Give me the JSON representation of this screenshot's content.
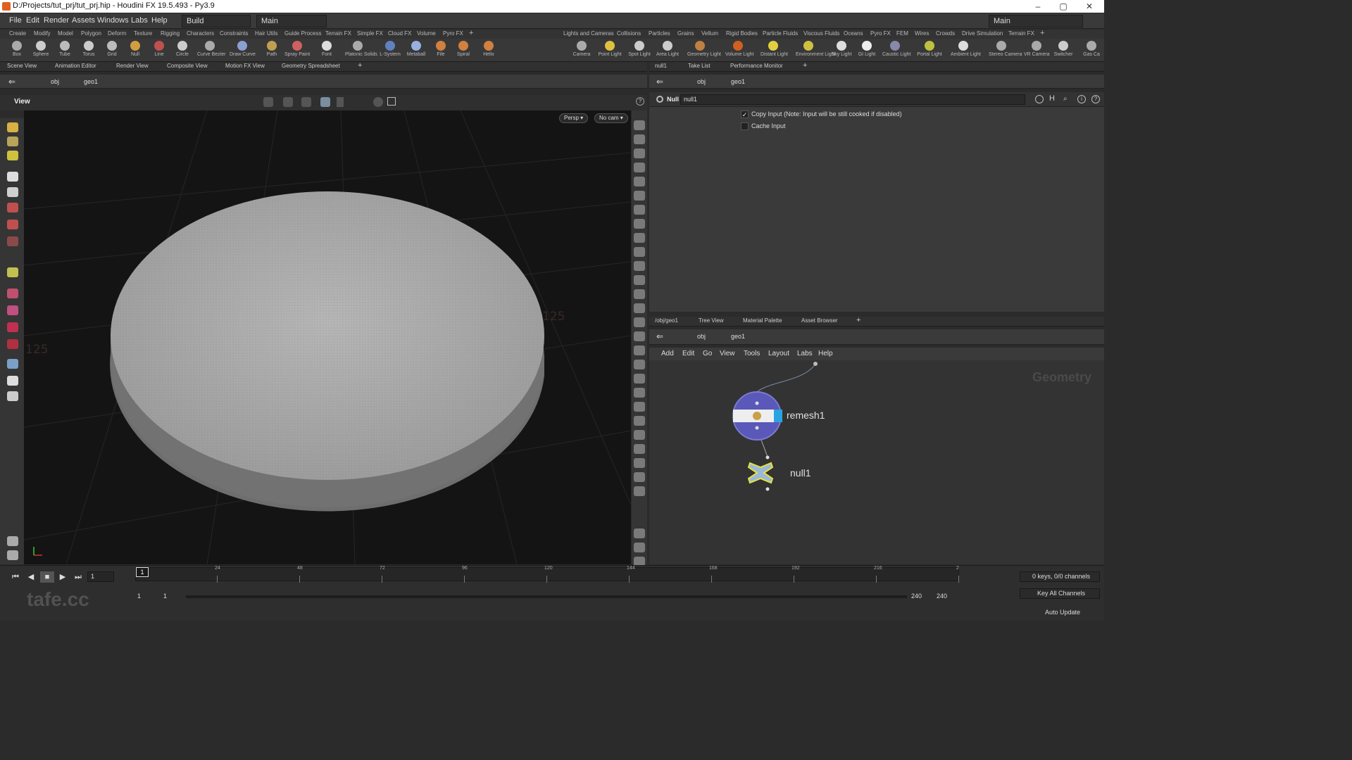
{
  "window": {
    "title": "D:/Projects/tut_prj/tut_prj.hip - Houdini FX 19.5.493 - Py3.9",
    "min": "–",
    "max": "▢",
    "close": "✕"
  },
  "menu": [
    "File",
    "Edit",
    "Render",
    "Assets",
    "Windows",
    "Labs",
    "Help"
  ],
  "desktop": {
    "build": "Build",
    "main": "Main",
    "right_main": "Main"
  },
  "shelf_tabs_left": [
    "Create",
    "Modify",
    "Model",
    "Polygon",
    "Deform",
    "Texture",
    "Rigging",
    "Characters",
    "Constraints",
    "Hair Utils",
    "Guide Process",
    "Terrain FX",
    "Simple FX",
    "Cloud FX",
    "Volume",
    "Pyro FX"
  ],
  "shelf_tabs_right": [
    "Lights and Cameras",
    "Collisions",
    "Particles",
    "Grains",
    "Vellum",
    "Rigid Bodies",
    "Particle Fluids",
    "Viscous Fluids",
    "Oceans",
    "Pyro FX",
    "FEM",
    "Wires",
    "Crowds",
    "Drive Simulation",
    "Terrain FX"
  ],
  "tools_left": [
    "Box",
    "Sphere",
    "Tube",
    "Torus",
    "Grid",
    "Null",
    "Line",
    "Circle",
    "Curve Bezier",
    "Draw Curve",
    "Path",
    "Spray Paint",
    "Font",
    "Platonic Solids",
    "L-System",
    "Metaball",
    "File",
    "Spiral",
    "Helix"
  ],
  "tools_right": [
    "Camera",
    "Point Light",
    "Spot Light",
    "Area Light",
    "Geometry Light",
    "Volume Light",
    "Distant Light",
    "Environment Light",
    "Sky Light",
    "GI Light",
    "Caustic Light",
    "Portal Light",
    "Ambient Light",
    "Stereo Camera",
    "VR Camera",
    "Switcher",
    "Gas Ca"
  ],
  "left_pane_tabs": [
    "Scene View",
    "Animation Editor",
    "Render View",
    "Composite View",
    "Motion FX View",
    "Geometry Spreadsheet"
  ],
  "right_pane_tabs": [
    "null1",
    "Take List",
    "Performance Monitor"
  ],
  "net_pane_tabs": [
    "/obj/geo1",
    "Tree View",
    "Material Palette",
    "Asset Browser"
  ],
  "path": {
    "obj": "obj",
    "geo": "geo1"
  },
  "viewport": {
    "title": "View",
    "persp": "Persp ▾",
    "cam": "No cam ▾",
    "grid_label_a": "125",
    "grid_label_b": "125"
  },
  "params": {
    "type": "Null",
    "name": "null1",
    "copy_input": "Copy Input (Note: Input will be still cooked if disabled)",
    "cache_input": "Cache Input",
    "copy_checked": true,
    "cache_checked": false
  },
  "netmenu": [
    "Add",
    "Edit",
    "Go",
    "View",
    "Tools",
    "Layout",
    "Labs",
    "Help"
  ],
  "network": {
    "context": "Geometry",
    "node1": "remesh1",
    "node2": "null1"
  },
  "timeline": {
    "ticks": [
      "24",
      "48",
      "72",
      "96",
      "120",
      "144",
      "168",
      "192",
      "216",
      "2"
    ],
    "current": "1",
    "frame_field": "1",
    "start": "1",
    "start2": "1",
    "end": "240",
    "end2": "240",
    "keys": "0 keys, 0/0 channels",
    "key_all": "Key All Channels",
    "auto_update": "Auto Update"
  },
  "watermark": "tafe.cc"
}
